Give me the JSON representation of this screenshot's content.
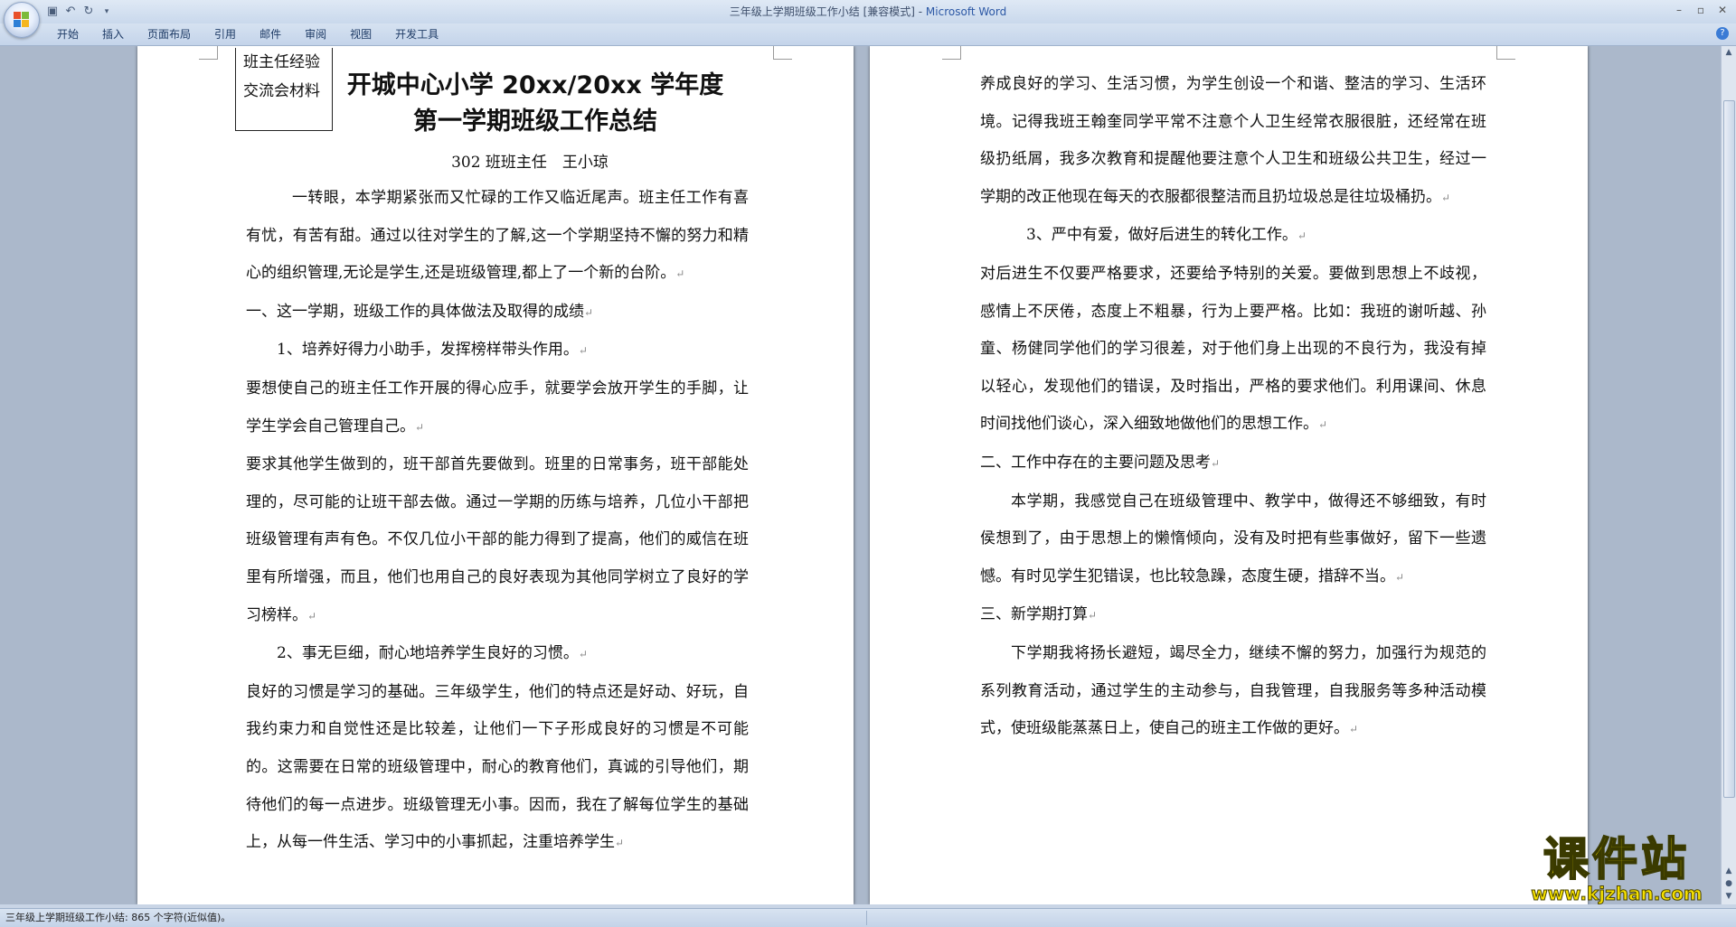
{
  "window": {
    "title": "三年级上学期班级工作小结 [兼容模式] - ",
    "app_name": "Microsoft Word"
  },
  "quick_access": [
    "save-icon",
    "undo-icon",
    "redo-icon",
    "customize-icon"
  ],
  "ribbon_tabs": [
    "开始",
    "插入",
    "页面布局",
    "引用",
    "邮件",
    "审阅",
    "视图",
    "开发工具"
  ],
  "document": {
    "box_line1": "班主任经验",
    "box_line2": "交流会材料",
    "title_line1": "开城中心小学 20xx/20xx 学年度",
    "title_line2": "第一学期班级工作总结",
    "author": "302 班班主任　王小琼",
    "left_paragraphs": [
      "一转眼，本学期紧张而又忙碌的工作又临近尾声。班主任工作有喜有忧，有苦有甜。通过以往对学生的了解,这一个学期坚持不懈的努力和精心的组织管理,无论是学生,还是班级管理,都上了一个新的台阶。",
      "一、这一学期，班级工作的具体做法及取得的成绩",
      "1、培养好得力小助手，发挥榜样带头作用。",
      "要想使自己的班主任工作开展的得心应手，就要学会放开学生的手脚，让学生学会自己管理自己。",
      "要求其他学生做到的，班干部首先要做到。班里的日常事务，班干部能处理的，尽可能的让班干部去做。通过一学期的历练与培养，几位小干部把班级管理有声有色。不仅几位小干部的能力得到了提高，他们的威信在班里有所增强，而且，他们也用自己的良好表现为其他同学树立了良好的学习榜样。",
      "2、事无巨细，耐心地培养学生良好的习惯。",
      "良好的习惯是学习的基础。三年级学生，他们的特点还是好动、好玩，自我约束力和自觉性还是比较差，让他们一下子形成良好的习惯是不可能的。这需要在日常的班级管理中，耐心的教育他们，真诚的引导他们，期待他们的每一点进步。班级管理无小事。因而，我在了解每位学生的基础上，从每一件生活、学习中的小事抓起，注重培养学生"
    ],
    "right_paragraphs": [
      "养成良好的学习、生活习惯，为学生创设一个和谐、整洁的学习、生活环境。记得我班王翰奎同学平常不注意个人卫生经常衣服很脏，还经常在班级扔纸屑，我多次教育和提醒他要注意个人卫生和班级公共卫生，经过一学期的改正他现在每天的衣服都很整洁而且扔垃圾总是往垃圾桶扔。",
      "3、严中有爱，做好后进生的转化工作。",
      "对后进生不仅要严格要求，还要给予特别的关爱。要做到思想上不歧视，感情上不厌倦，态度上不粗暴，行为上要严格。比如：我班的谢听越、孙童、杨健同学他们的学习很差，对于他们身上出现的不良行为，我没有掉以轻心，发现他们的错误，及时指出，严格的要求他们。利用课间、休息时间找他们谈心，深入细致地做他们的思想工作。",
      "二、工作中存在的主要问题及思考",
      "本学期，我感觉自己在班级管理中、教学中，做得还不够细致，有时侯想到了，由于思想上的懒惰倾向，没有及时把有些事做好，留下一些遗憾。有时见学生犯错误，也比较急躁，态度生硬，措辞不当。",
      "三、新学期打算",
      "下学期我将扬长避短，竭尽全力，继续不懈的努力，加强行为规范的系列教育活动，通过学生的主动参与，自我管理，自我服务等多种活动模式，使班级能蒸蒸日上，使自己的班主工作做的更好。"
    ],
    "paragraph_mark": "↵"
  },
  "status": {
    "text": "三年级上学期班级工作小结: 865 个字符(近似值)。"
  },
  "watermark": {
    "main": "课件站",
    "url": "www.kjzhan.com"
  },
  "colors": {
    "workspace_bg": "#abb8cb",
    "ribbon_bg": "#c4d4ea",
    "title_app": "#2c58a5",
    "watermark": "#f7e400"
  }
}
